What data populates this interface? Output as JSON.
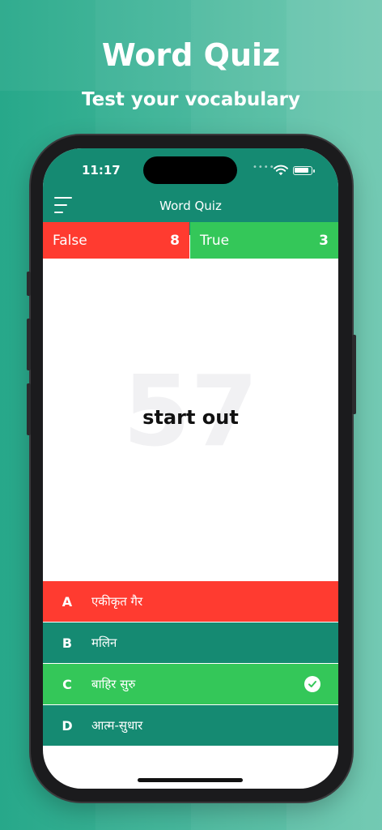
{
  "promo": {
    "title": "Word Quiz",
    "subtitle": "Test your vocabulary"
  },
  "status_bar": {
    "time": "11:17",
    "icons": [
      "wifi-icon",
      "battery-icon"
    ]
  },
  "nav": {
    "title": "Word Quiz",
    "menu_icon": "menu-icon"
  },
  "scores": {
    "false_label": "False",
    "false_count": "8",
    "true_label": "True",
    "true_count": "3"
  },
  "question": {
    "background_number": "57",
    "word": "start out"
  },
  "answers": [
    {
      "letter": "A",
      "text": "एकीकृत गैर",
      "state": "wrong"
    },
    {
      "letter": "B",
      "text": "मलिन",
      "state": "neutral"
    },
    {
      "letter": "C",
      "text": "बाहिर सुरु",
      "state": "correct"
    },
    {
      "letter": "D",
      "text": "आत्म-सुधार",
      "state": "neutral"
    }
  ],
  "colors": {
    "primary": "#158a72",
    "wrong": "#ff3b30",
    "correct": "#34c759"
  }
}
